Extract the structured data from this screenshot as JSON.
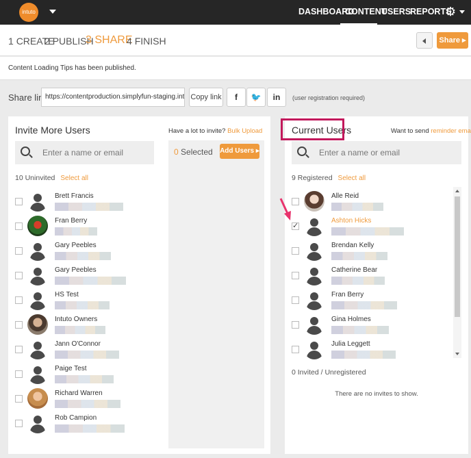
{
  "app": {
    "logo_text": "intuto"
  },
  "nav": {
    "items": [
      "DASHBOARD",
      "CONTENT",
      "USERS",
      "REPORTS"
    ],
    "active": "CONTENT",
    "settings_icon": "gear-icon"
  },
  "steps": [
    {
      "num": "1",
      "label": "CREATE"
    },
    {
      "num": "2",
      "label": "PUBLISH"
    },
    {
      "num": "3",
      "label": "SHARE"
    },
    {
      "num": "4",
      "label": "FINISH"
    }
  ],
  "share_button": "Share",
  "notice": {
    "title": "Content Loading Tips",
    "suffix": " has been published."
  },
  "share_link": {
    "label": "Share link",
    "url": "https://contentproduction.simplyfun-staging.intuto.com/ac",
    "copy_label": "Copy link",
    "note": "(user registration required)"
  },
  "invite": {
    "title": "Invite More Users",
    "bulk_prompt": "Have a lot to invite?",
    "bulk_link": "Bulk Upload",
    "search_placeholder": "Enter a name or email",
    "count_label": "10 Uninvited",
    "select_all": "Select all",
    "selected_count": "0",
    "selected_label": " Selected",
    "add_button": "Add Users",
    "users": [
      {
        "name": "Brett Francis"
      },
      {
        "name": "Fran Berry"
      },
      {
        "name": "Gary Peebles"
      },
      {
        "name": "Gary Peebles"
      },
      {
        "name": "HS Test"
      },
      {
        "name": "Intuto Owners"
      },
      {
        "name": "Jann O'Connor"
      },
      {
        "name": "Paige Test"
      },
      {
        "name": "Richard Warren"
      },
      {
        "name": "Rob Campion"
      }
    ]
  },
  "current": {
    "title": "Current Users",
    "reminder_prompt": "Want to send",
    "reminder_link": "reminder emails?",
    "search_placeholder": "Enter a name or email",
    "count_label": "9 Registered",
    "select_all": "Select all",
    "users": [
      {
        "name": "Alle Reid",
        "checked": false
      },
      {
        "name": "Ashton Hicks",
        "checked": true
      },
      {
        "name": "Brendan Kelly",
        "checked": false
      },
      {
        "name": "Catherine Bear",
        "checked": false
      },
      {
        "name": "Fran Berry",
        "checked": false
      },
      {
        "name": "Gina Holmes",
        "checked": false
      },
      {
        "name": "Julia Leggett",
        "checked": false
      }
    ],
    "invited_label": "0 Invited / Unregistered",
    "no_invites": "There are no invites to show."
  }
}
